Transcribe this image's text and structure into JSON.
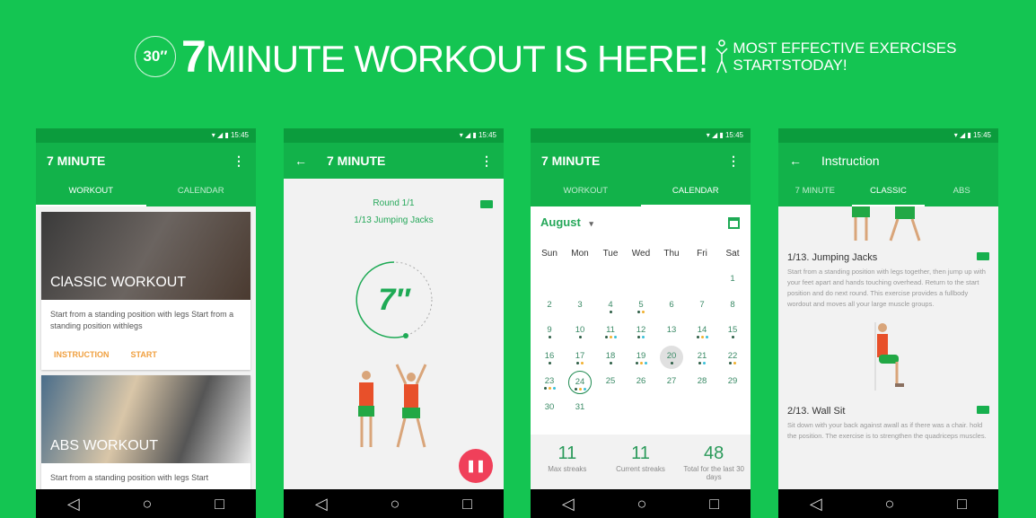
{
  "banner": {
    "badge": "30″",
    "headline_num": "7",
    "headline": "MINUTE WORKOUT IS HERE!",
    "sub1": "MOST EFFECTIVE EXERCISES",
    "sub2": "STARTSTODAY!"
  },
  "status_time": "15:45",
  "phone1": {
    "title": "7 MINUTE",
    "tabs": [
      "WORKOUT",
      "CALENDAR"
    ],
    "cards": [
      {
        "title": "ClASSIC WORKOUT",
        "desc": "Start from a standing position with legs Start from a standing position withlegs",
        "actions": [
          "INSTRUCTION",
          "START"
        ]
      },
      {
        "title": "ABS WORKOUT",
        "desc": "Start from a standing position with legs Start"
      }
    ]
  },
  "phone2": {
    "title": "7 MINUTE",
    "round": "Round 1/1",
    "exercise": "1/13 Jumping Jacks",
    "timer": "7″"
  },
  "phone3": {
    "title": "7 MINUTE",
    "tabs": [
      "WORKOUT",
      "CALENDAR"
    ],
    "month": "August",
    "weekdays": [
      "Sun",
      "Mon",
      "Tue",
      "Wed",
      "Thu",
      "Fri",
      "Sat"
    ],
    "first_weekday": 6,
    "days_in_month": 31,
    "highlighted_day": 20,
    "today": 24,
    "dots": {
      "4": [
        "d"
      ],
      "5": [
        "d",
        "o"
      ],
      "9": [
        "d"
      ],
      "10": [
        "d"
      ],
      "11": [
        "d",
        "o",
        "b"
      ],
      "12": [
        "d",
        "b"
      ],
      "14": [
        "d",
        "o",
        "b"
      ],
      "15": [
        "d"
      ],
      "16": [
        "d"
      ],
      "17": [
        "d",
        "o"
      ],
      "18": [
        "d"
      ],
      "19": [
        "d",
        "o",
        "b"
      ],
      "20": [
        "d"
      ],
      "21": [
        "d",
        "b"
      ],
      "22": [
        "d",
        "o"
      ],
      "23": [
        "d",
        "o",
        "b"
      ],
      "24": [
        "d",
        "o",
        "b"
      ]
    },
    "dot_colors": {
      "d": "#2d5e46",
      "o": "#f0b030",
      "b": "#3bc0d8"
    },
    "stats": [
      {
        "n": "11",
        "l": "Max streaks"
      },
      {
        "n": "11",
        "l": "Current streaks"
      },
      {
        "n": "48",
        "l": "Total for the last 30 days"
      }
    ]
  },
  "phone4": {
    "title": "Instruction",
    "tabs": [
      "7 MINUTE",
      "CLASSIC",
      "ABS"
    ],
    "exercises": [
      {
        "title": "1/13. Jumping Jacks",
        "desc": "Start from a standing position with legs together, then jump up with your feet apart and hands touching overhead. Return to the start position and do next round. This exercise provides a fullbody wordout and moves all your large muscle groups."
      },
      {
        "title": "2/13. Wall Sit",
        "desc": "Sit down with your back against awall as if there was a chair. hold the position. The exercise is to strengthen the quadriceps muscles."
      }
    ]
  }
}
